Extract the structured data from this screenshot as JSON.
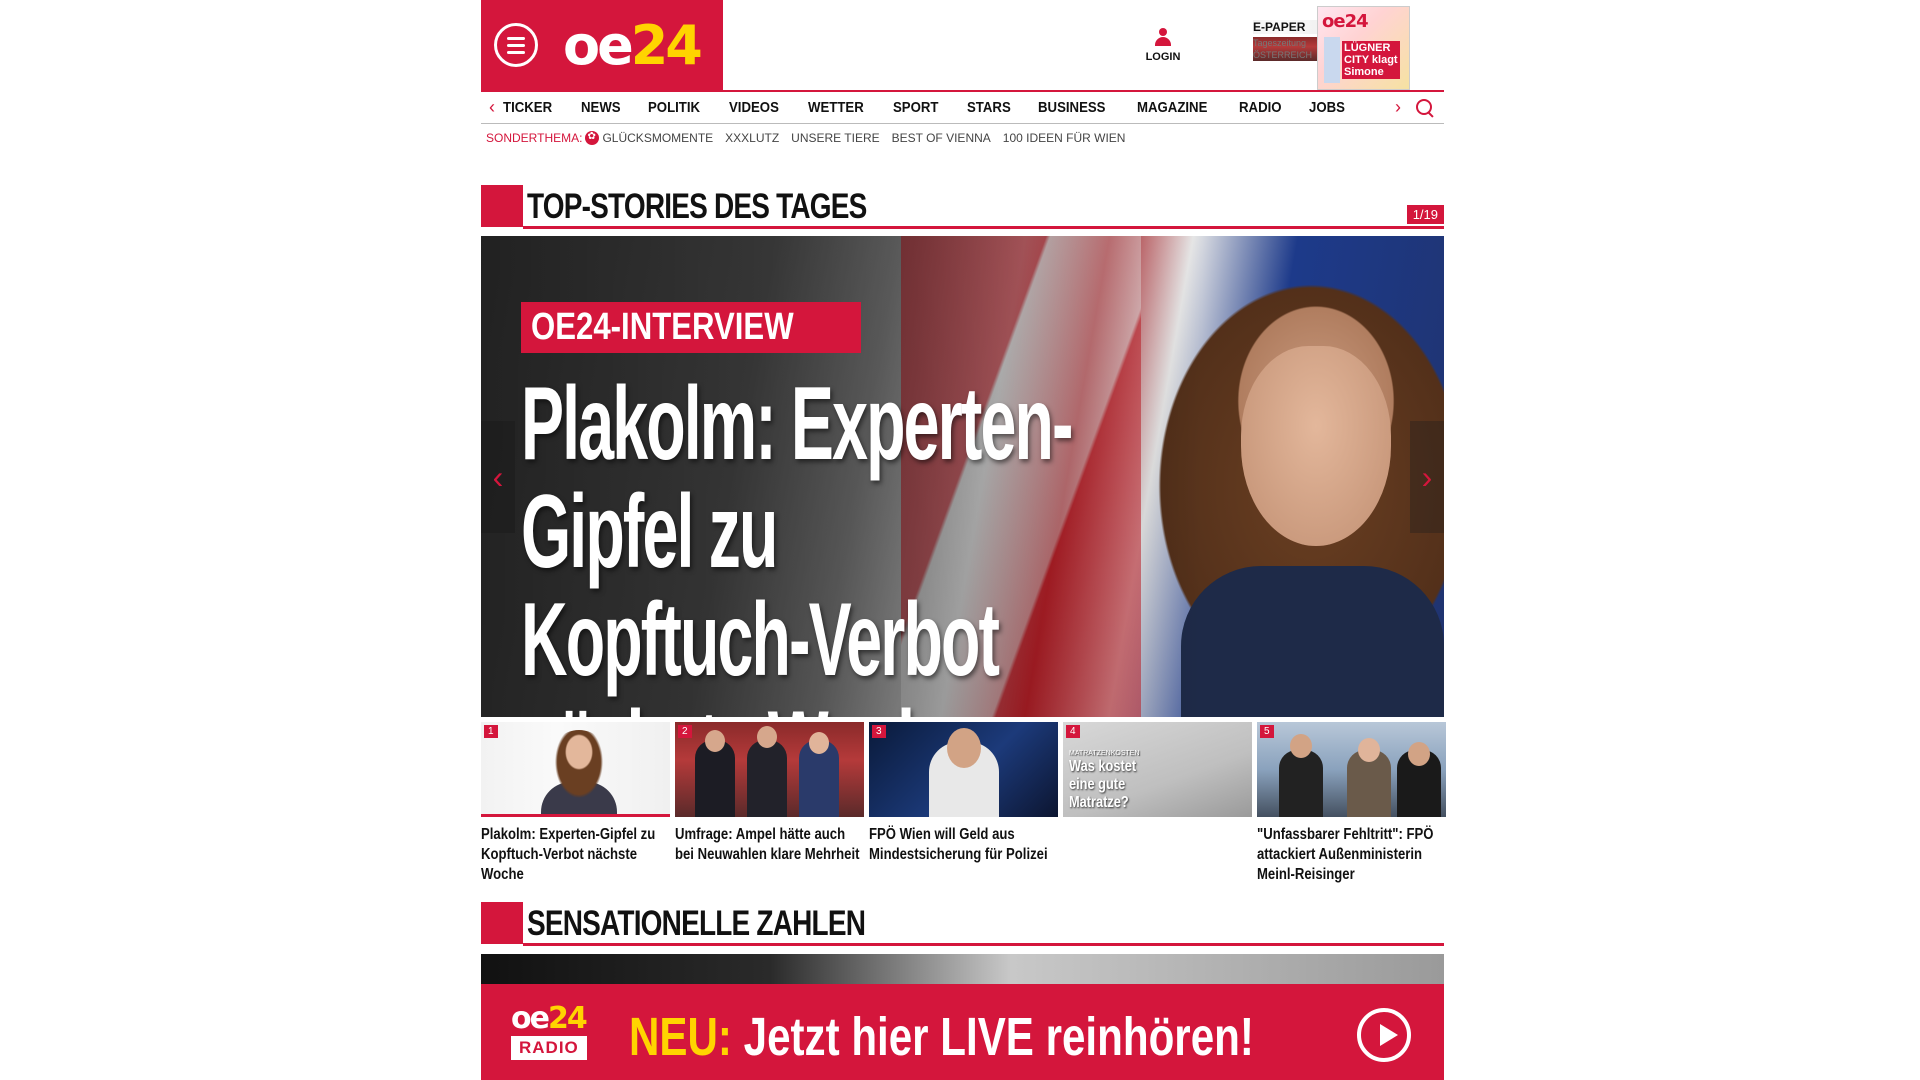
{
  "header": {
    "logo_main": "oe",
    "logo_accent": "24",
    "login_label": "LOGIN",
    "epaper_title": "E-PAPER",
    "epaper_sub1": "Tageszeitung",
    "epaper_sub2": "ÖSTERREICH",
    "epaper_cover_brand": "oe24",
    "epaper_cover_headline": "LÜGNER CITY klagt Simone"
  },
  "nav": {
    "items": [
      "TICKER",
      "NEWS",
      "POLITIK",
      "VIDEOS",
      "WETTER",
      "SPORT",
      "STARS",
      "BUSINESS",
      "MAGAZINE",
      "RADIO",
      "JOBS"
    ]
  },
  "subnav": {
    "label": "SONDERTHEMA:",
    "items": [
      "GLÜCKSMOMENTE",
      "XXXLUTZ",
      "UNSERE TIERE",
      "BEST OF VIENNA",
      "100 IDEEN FÜR WIEN"
    ]
  },
  "top_stories": {
    "title": "TOP-STORIES DES TAGES",
    "counter": "1/19",
    "hero": {
      "kicker": "OE24-INTERVIEW",
      "headline": "Plakolm: Experten-Gipfel zu Kopftuch-Verbot nächste Woche"
    },
    "thumbs": [
      {
        "num": "1",
        "caption": "Plakolm: Experten-Gipfel zu Kopftuch-Verbot nächste Woche"
      },
      {
        "num": "2",
        "caption": "Umfrage: Ampel hätte auch bei Neuwahlen klare Mehrheit"
      },
      {
        "num": "3",
        "caption": "FPÖ Wien will Geld aus Mindestsicherung für Polizei"
      },
      {
        "num": "4",
        "caption": "",
        "overlay_small": "MATRATZENKOSTEN",
        "overlay": "Was kostet eine gute Matratze?"
      },
      {
        "num": "5",
        "caption": "\"Unfassbarer Fehltritt\": FPÖ attackiert Außenministerin Meinl-Reisinger"
      }
    ]
  },
  "sensation": {
    "title": "SENSATIONELLE ZAHLEN"
  },
  "radio_banner": {
    "logo_main": "oe",
    "logo_accent": "24",
    "logo_sub": "RADIO",
    "msg_accent": "NEU:",
    "msg_text": " Jetzt hier LIVE reinhören!"
  },
  "colors": {
    "brand_red": "#d4163c",
    "brand_yellow": "#ffd400"
  }
}
